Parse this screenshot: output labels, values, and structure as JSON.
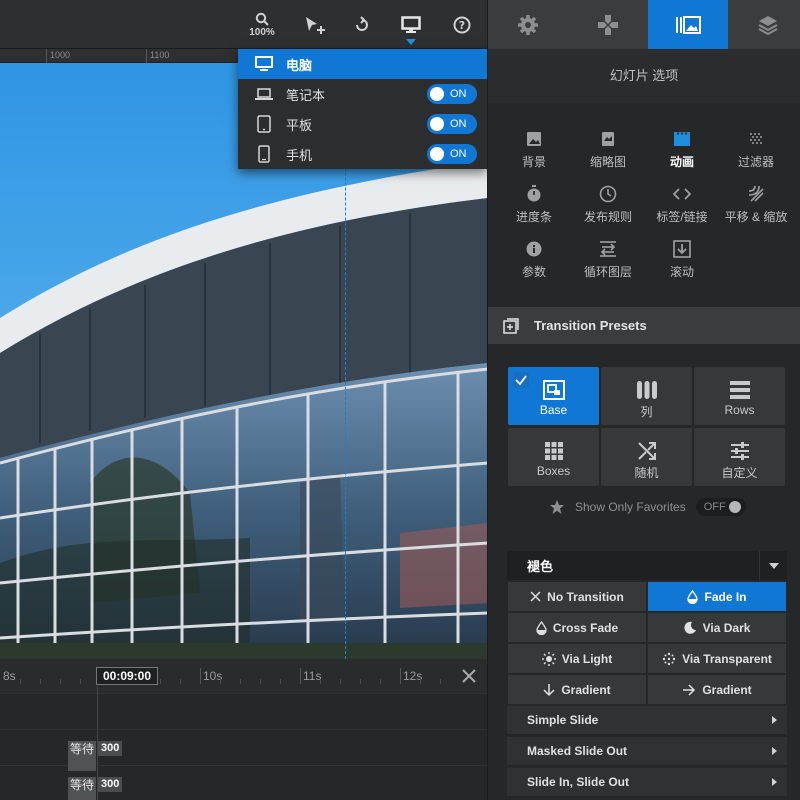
{
  "toolbar": {
    "zoom_label": "100%",
    "active_tool": "desktop-view",
    "tools": [
      "zoom",
      "add-element",
      "undo",
      "desktop-view",
      "help"
    ]
  },
  "ruler": {
    "ticks": [
      "1000",
      "1100"
    ]
  },
  "device_menu": {
    "items": [
      {
        "label": "电脑",
        "selected": true
      },
      {
        "label": "笔记本",
        "toggle": "ON"
      },
      {
        "label": "平板",
        "toggle": "ON"
      },
      {
        "label": "手机",
        "toggle": "ON"
      }
    ]
  },
  "timeline": {
    "current_time": "00:09:00",
    "labels": [
      "8s",
      "10s",
      "11s",
      "12s"
    ],
    "rows": [
      {
        "wait_label": "等待",
        "duration": "300"
      },
      {
        "wait_label": "等待",
        "duration": "300"
      }
    ]
  },
  "right_panel": {
    "title": "幻灯片 选项",
    "options": [
      {
        "label": "背景",
        "icon": "image-icon"
      },
      {
        "label": "缩略图",
        "icon": "thumbnail-icon"
      },
      {
        "label": "动画",
        "icon": "film-icon",
        "active": true
      },
      {
        "label": "过滤器",
        "icon": "filter-icon"
      },
      {
        "label": "进度条",
        "icon": "stopwatch-icon"
      },
      {
        "label": "发布规则",
        "icon": "clock-icon"
      },
      {
        "label": "标签/链接",
        "icon": "code-icon"
      },
      {
        "label": "平移 & 缩放",
        "icon": "pan-zoom-icon"
      },
      {
        "label": "参数",
        "icon": "info-icon"
      },
      {
        "label": "循环图层",
        "icon": "loop-icon"
      },
      {
        "label": "滚动",
        "icon": "scroll-icon"
      }
    ],
    "presets_title": "Transition Presets",
    "presets": [
      {
        "label": "Base",
        "active": true
      },
      {
        "label": "列"
      },
      {
        "label": "Rows"
      },
      {
        "label": "Boxes"
      },
      {
        "label": "随机"
      },
      {
        "label": "自定义"
      }
    ],
    "favorites_label": "Show Only Favorites",
    "favorites_toggle": "OFF",
    "category": "褪色",
    "transitions": [
      {
        "label": "No Transition"
      },
      {
        "label": "Fade In",
        "active": true
      },
      {
        "label": "Cross Fade"
      },
      {
        "label": "Via Dark"
      },
      {
        "label": "Via Light"
      },
      {
        "label": "Via Transparent"
      },
      {
        "label": "Gradient"
      },
      {
        "label": "Gradient"
      }
    ],
    "groups": [
      "Simple Slide",
      "Masked Slide Out",
      "Slide In, Slide Out"
    ]
  },
  "colors": {
    "accent": "#1177d4",
    "panel": "#262728",
    "sky": "#3f9ee0"
  }
}
